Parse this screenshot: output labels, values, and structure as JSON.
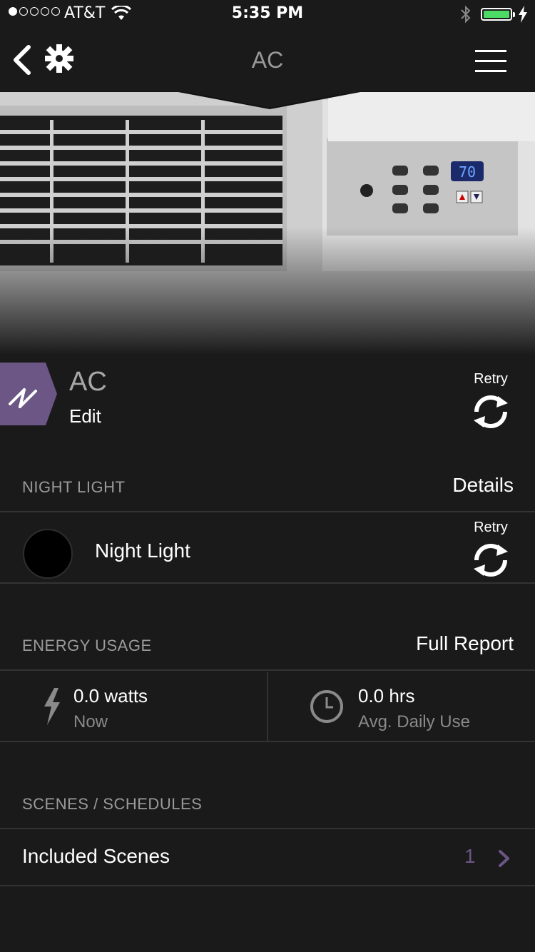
{
  "status_bar": {
    "carrier": "AT&T",
    "time": "5:35 PM",
    "signal_bars_filled": 1,
    "signal_bars_total": 5,
    "battery_level": 1.0,
    "battery_color": "#4cd964"
  },
  "nav": {
    "title": "AC",
    "back_icon": "chevron-left-icon",
    "gear_icon": "gear-icon",
    "menu_icon": "hamburger-menu-icon"
  },
  "device": {
    "name": "AC",
    "edit_label": "Edit",
    "retry_label": "Retry",
    "badge_color": "#6b5685"
  },
  "night_light_section": {
    "header": "NIGHT LIGHT",
    "action": "Details",
    "item_label": "Night Light",
    "retry_label": "Retry"
  },
  "energy_section": {
    "header": "ENERGY USAGE",
    "action": "Full Report",
    "power_value": "0.0 watts",
    "power_sub": "Now",
    "hours_value": "0.0 hrs",
    "hours_sub": "Avg. Daily Use"
  },
  "scenes_section": {
    "header": "SCENES / SCHEDULES",
    "included_label": "Included Scenes",
    "included_count": "1"
  },
  "hero_display": {
    "temperature_readout": "70"
  },
  "colors": {
    "background": "#1a1a1a",
    "accent_purple": "#6b5685",
    "divider": "#333333"
  }
}
